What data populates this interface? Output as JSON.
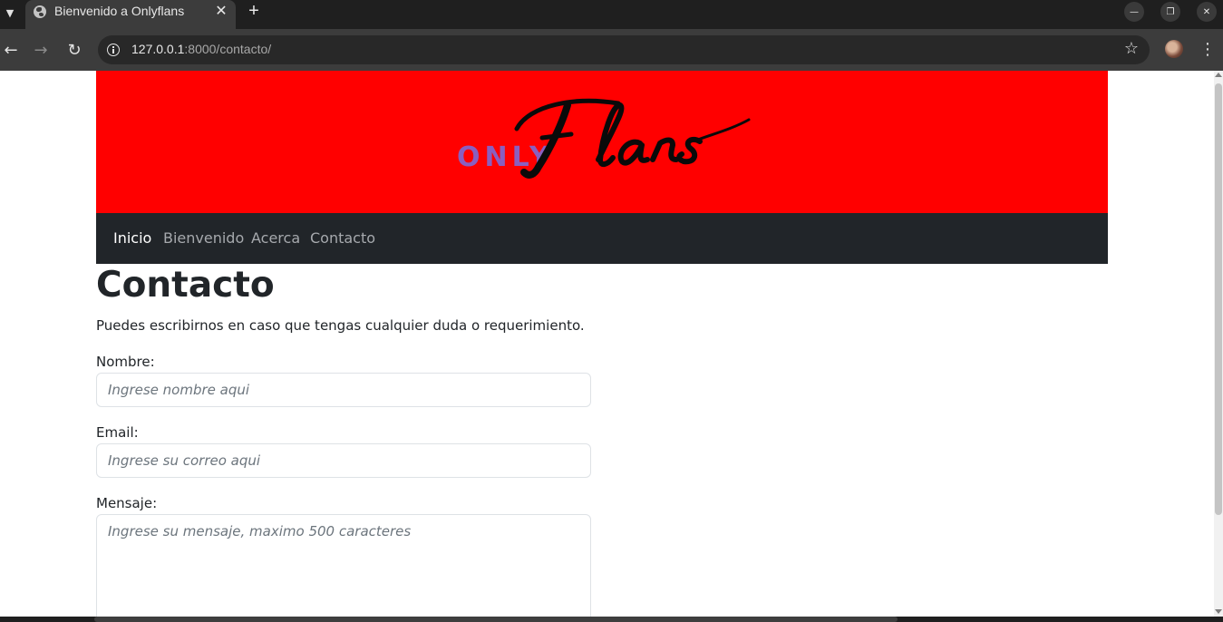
{
  "browser": {
    "tab_title": "Bienvenido a Onlyflans",
    "url_host": "127.0.0.1",
    "url_path": ":8000/contacto/"
  },
  "site": {
    "logo_only": "ONLY",
    "logo_flans": "Flans",
    "banner_color": "#ff0000",
    "navbar_color": "#212529",
    "nav": [
      {
        "label": "Inicio",
        "active": true
      },
      {
        "label": "Bienvenido",
        "active": false
      },
      {
        "label": "Acerca",
        "active": false
      },
      {
        "label": "Contacto",
        "active": false
      }
    ]
  },
  "contact": {
    "title": "Contacto",
    "intro": "Puedes escribirnos en caso que tengas cualquier duda o requerimiento.",
    "name_label": "Nombre:",
    "name_placeholder": "Ingrese nombre aqui",
    "email_label": "Email:",
    "email_placeholder": "Ingrese su correo aqui",
    "message_label": "Mensaje:",
    "message_placeholder": "Ingrese su mensaje, maximo 500 caracteres"
  }
}
